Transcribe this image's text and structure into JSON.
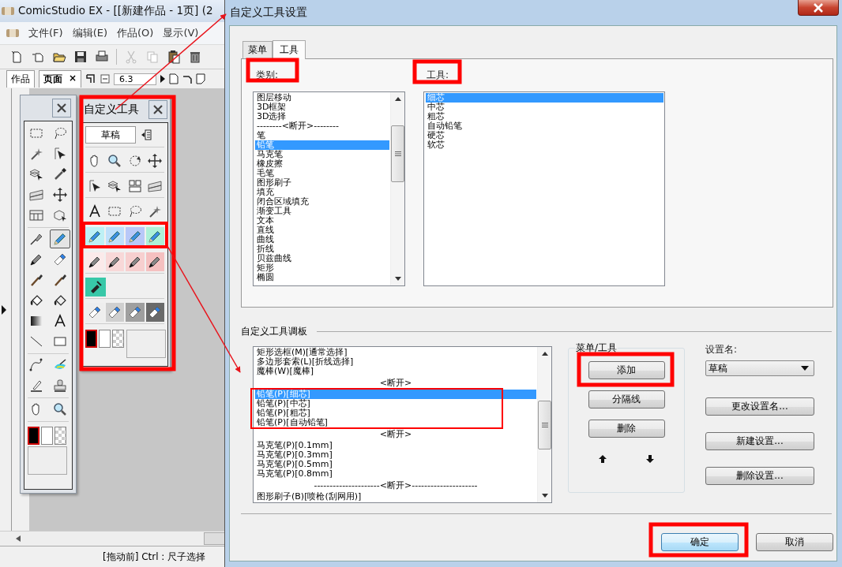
{
  "app": {
    "title": "ComicStudio EX - [[新建作品 - 1页] (2",
    "menu": [
      "文件(F)",
      "编辑(E)",
      "作品(O)",
      "显示(V)"
    ],
    "tabs": [
      {
        "label": "作品",
        "selected": false
      },
      {
        "label": "页面",
        "selected": true,
        "close": "×"
      }
    ],
    "zoom": "6.3",
    "status": "[拖动前] Ctrl : 尺子选择"
  },
  "toolbox": {
    "tools": [
      {
        "selected": false
      },
      {
        "selected": false
      },
      {
        "selected": false
      },
      {
        "selected": false
      },
      {
        "selected": false
      },
      {
        "selected": false
      },
      {
        "selected": false
      },
      {
        "selected": false
      },
      {
        "selected": false
      },
      {
        "selected": false
      },
      {
        "selected": false
      },
      {
        "selected": true
      },
      {
        "selected": false
      },
      {
        "selected": false
      },
      {
        "selected": false
      },
      {
        "selected": false
      },
      {
        "selected": false
      },
      {
        "selected": false
      },
      {
        "selected": false
      },
      {
        "selected": false
      },
      {
        "selected": false
      },
      {
        "selected": false
      },
      {
        "selected": false
      },
      {
        "selected": false
      },
      {
        "selected": false
      },
      {
        "selected": false
      },
      {
        "selected": false
      },
      {
        "selected": false
      }
    ],
    "swatches": [
      {
        "selected": true
      },
      {
        "selected": false
      },
      {
        "selected": false
      }
    ]
  },
  "custom_palette": {
    "title": "自定义工具",
    "setting": "草稿",
    "swatches": [
      {
        "selected": true
      },
      {
        "selected": false
      },
      {
        "selected": false
      }
    ]
  },
  "dialog": {
    "title": "自定义工具设置",
    "tabs": [
      {
        "label": "菜单",
        "selected": false
      },
      {
        "label": "工具",
        "selected": true
      }
    ],
    "category_label": "类别:",
    "categories": [
      {
        "text": "图层移动",
        "selected": false
      },
      {
        "text": "3D框架",
        "selected": false
      },
      {
        "text": "3D选择",
        "selected": false
      },
      {
        "text": "--------<断开>--------",
        "selected": false
      },
      {
        "text": "笔",
        "selected": false
      },
      {
        "text": "铅笔",
        "selected": true
      },
      {
        "text": "马克笔",
        "selected": false
      },
      {
        "text": "橡皮擦",
        "selected": false
      },
      {
        "text": "毛笔",
        "selected": false
      },
      {
        "text": "图形刷子",
        "selected": false
      },
      {
        "text": "填充",
        "selected": false
      },
      {
        "text": "闭合区域填充",
        "selected": false
      },
      {
        "text": "渐变工具",
        "selected": false
      },
      {
        "text": "文本",
        "selected": false
      },
      {
        "text": "直线",
        "selected": false
      },
      {
        "text": "曲线",
        "selected": false
      },
      {
        "text": "折线",
        "selected": false
      },
      {
        "text": "贝兹曲线",
        "selected": false
      },
      {
        "text": "矩形",
        "selected": false
      },
      {
        "text": "椭圆",
        "selected": false
      }
    ],
    "tool_label": "工具:",
    "tools": [
      {
        "text": "细芯",
        "selected": true
      },
      {
        "text": "中芯",
        "selected": false
      },
      {
        "text": "粗芯",
        "selected": false
      },
      {
        "text": "自动铅笔",
        "selected": false
      },
      {
        "text": "硬芯",
        "selected": false
      },
      {
        "text": "软芯",
        "selected": false
      }
    ],
    "palette_label": "自定义工具调板",
    "palette_items": [
      {
        "kind": "item",
        "text": "矩形选框(M)[通常选择]",
        "selected": false
      },
      {
        "kind": "item",
        "text": "多边形套索(L)[折线选择]",
        "selected": false
      },
      {
        "kind": "item",
        "text": "魔棒(W)[魔棒]",
        "selected": false
      },
      {
        "kind": "separator",
        "text": "<断开>",
        "selected": false
      },
      {
        "kind": "item",
        "text": "铅笔(P)[细芯]",
        "selected": true
      },
      {
        "kind": "item",
        "text": "铅笔(P)[中芯]",
        "selected": false
      },
      {
        "kind": "item",
        "text": "铅笔(P)[粗芯]",
        "selected": false
      },
      {
        "kind": "item",
        "text": "铅笔(P)[自动铅笔]",
        "selected": false
      },
      {
        "kind": "separator",
        "text": "<断开>",
        "selected": false
      },
      {
        "kind": "item",
        "text": "马克笔(P)[0.1mm]",
        "selected": false
      },
      {
        "kind": "item",
        "text": "马克笔(P)[0.3mm]",
        "selected": false
      },
      {
        "kind": "item",
        "text": "马克笔(P)[0.5mm]",
        "selected": false
      },
      {
        "kind": "item",
        "text": "马克笔(P)[0.8mm]",
        "selected": false
      },
      {
        "kind": "separator",
        "text": "---------------------<断开>---------------------",
        "selected": false
      },
      {
        "kind": "item",
        "text": "图形刷子(B)[喷枪(刮网用)]",
        "selected": false
      }
    ],
    "group_label": "菜单/工具",
    "group_buttons": [
      "添加",
      "分隔线",
      "删除"
    ],
    "setting_label": "设置名:",
    "setting_value": "草稿",
    "setting_buttons": [
      "更改设置名...",
      "新建设置...",
      "删除设置..."
    ],
    "ok": "确定",
    "cancel": "取消"
  }
}
